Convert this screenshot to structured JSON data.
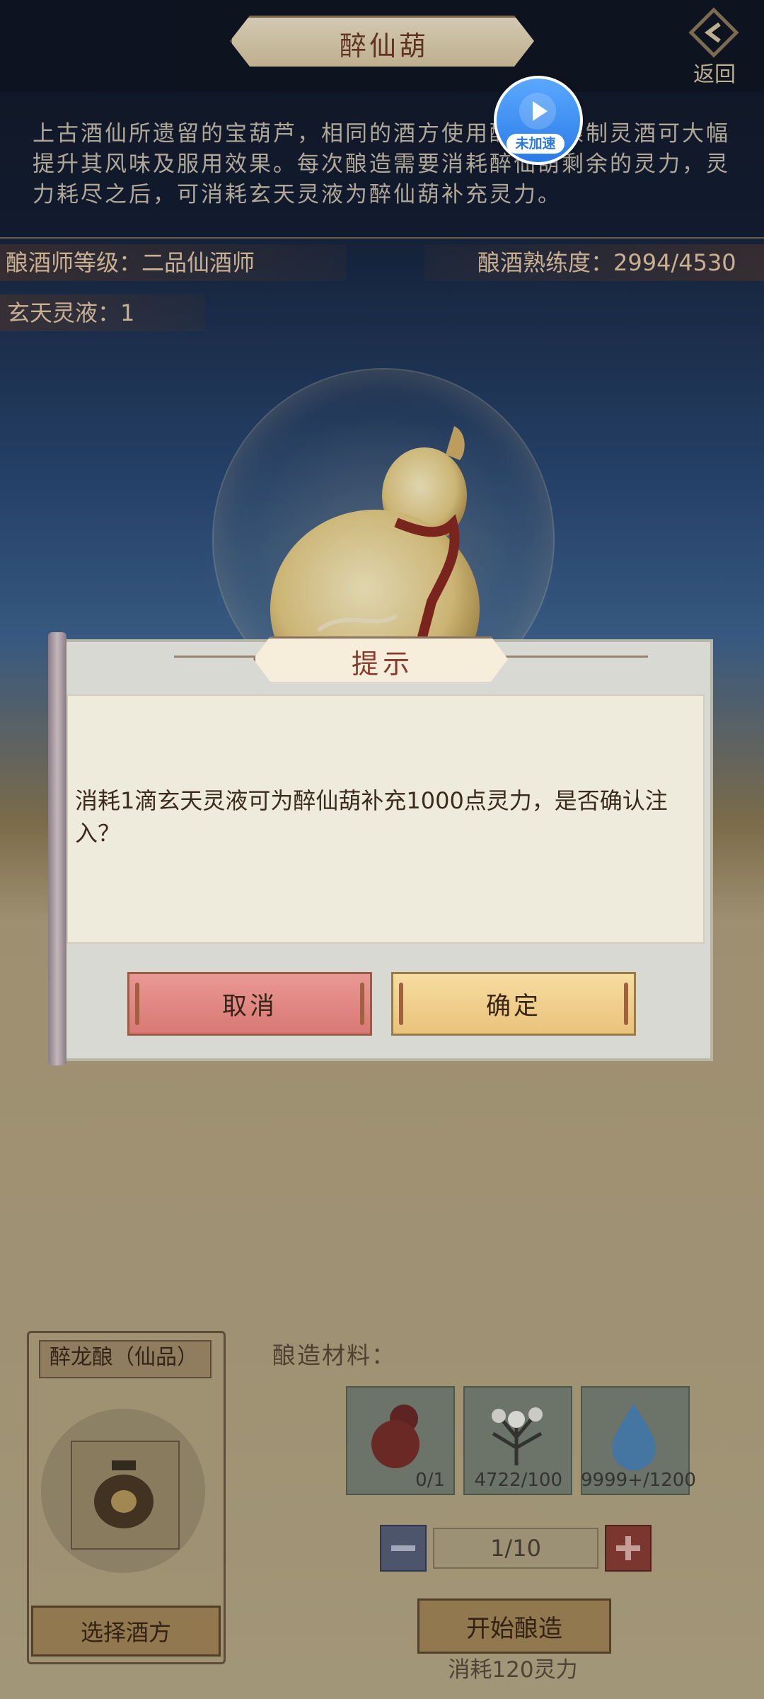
{
  "header": {
    "title": "醉仙葫",
    "back_label": "返回"
  },
  "speed_badge": {
    "label": "未加速"
  },
  "description": "上古酒仙所遗留的宝葫芦，相同的酒方使用醉仙葫酿制灵酒可大幅提升其风味及服用效果。每次酿造需要消耗醉仙葫剩余的灵力，灵力耗尽之后，可消耗玄天灵液为醉仙葫补充灵力。",
  "stats": {
    "brewer_level": "酿酒师等级：二品仙酒师",
    "brewing_skill": "酿酒熟练度：2994/4530",
    "xuantian_liquid": "玄天灵液：1"
  },
  "recipe": {
    "name": "醉龙酿（仙品）",
    "choose_label": "选择酒方"
  },
  "materials": {
    "label": "酿造材料：",
    "items": [
      {
        "icon": "gourd-icon",
        "count": "0/1"
      },
      {
        "icon": "herb-icon",
        "count": "4722/100"
      },
      {
        "icon": "water-drop-icon",
        "count": "9999+/1200"
      }
    ],
    "quantity": "1/10"
  },
  "brew": {
    "start_label": "开始酿造",
    "cost_label": "消耗120灵力"
  },
  "dialog": {
    "title": "提示",
    "message": "消耗1滴玄天灵液可为醉仙葫补充1000点灵力，是否确认注入？",
    "cancel_label": "取消",
    "confirm_label": "确定"
  },
  "colors": {
    "cancel": "#e08884",
    "confirm": "#f0cf8c",
    "title_text": "#8a3a2c",
    "speed_badge": "#3b8ff2"
  }
}
